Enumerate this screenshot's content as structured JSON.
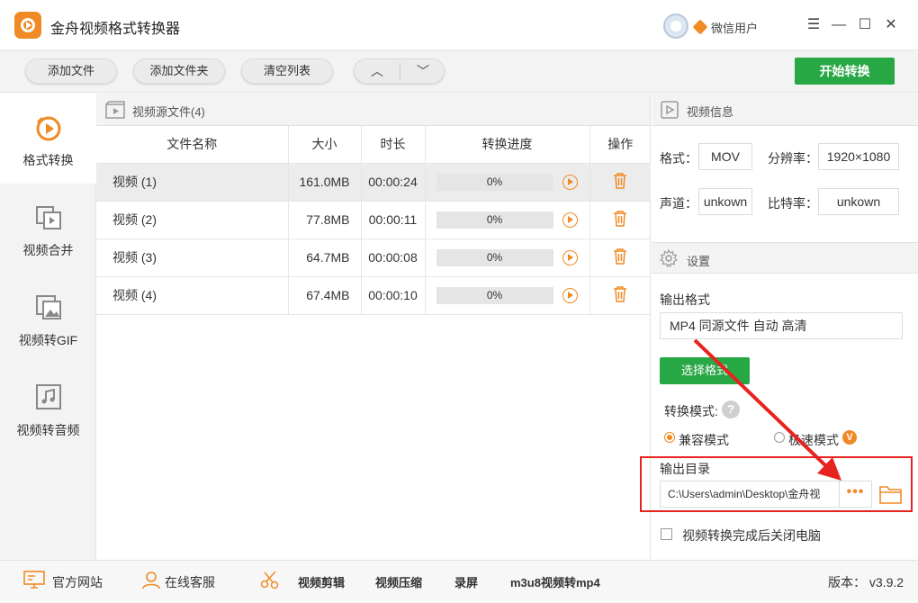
{
  "app": {
    "title": "金舟视频格式转换器",
    "user_name": "微信用户"
  },
  "window_controls": {
    "menu": "☰",
    "minimize": "—",
    "maximize": "☐",
    "close": "✕"
  },
  "toolbar": {
    "add_file": "添加文件",
    "add_folder": "添加文件夹",
    "clear_list": "清空列表",
    "move_up": "︿",
    "move_down": "﹀",
    "start_convert": "开始转换"
  },
  "sidebar": {
    "items": [
      {
        "label": "格式转换",
        "icon": "format-convert-icon",
        "active": true
      },
      {
        "label": "视频合并",
        "icon": "video-merge-icon",
        "active": false
      },
      {
        "label": "视频转GIF",
        "icon": "video-to-gif-icon",
        "active": false
      },
      {
        "label": "视频转音频",
        "icon": "video-to-audio-icon",
        "active": false
      }
    ]
  },
  "file_list": {
    "header": "视频源文件(4)",
    "columns": [
      "文件名称",
      "大小",
      "时长",
      "转换进度",
      "操作"
    ],
    "rows": [
      {
        "name": "视频 (1)",
        "size": "161.0MB",
        "duration": "00:00:24",
        "progress": 0,
        "progress_text": "0%"
      },
      {
        "name": "视频 (2)",
        "size": "77.8MB",
        "duration": "00:00:11",
        "progress": 0,
        "progress_text": "0%"
      },
      {
        "name": "视频 (3)",
        "size": "64.7MB",
        "duration": "00:00:08",
        "progress": 0,
        "progress_text": "0%"
      },
      {
        "name": "视频 (4)",
        "size": "67.4MB",
        "duration": "00:00:10",
        "progress": 0,
        "progress_text": "0%"
      }
    ]
  },
  "video_info": {
    "header": "视频信息",
    "format_label": "格式：",
    "format_value": "MOV",
    "resolution_label": "分辨率：",
    "resolution_value": "1920×1080",
    "channel_label": "声道：",
    "channel_value": "unkown",
    "bitrate_label": "比特率：",
    "bitrate_value": "unkown"
  },
  "settings": {
    "header": "设置",
    "output_format_label": "输出格式",
    "output_format_value": "MP4 同源文件 自动 高清",
    "select_format_button": "选择格式",
    "convert_mode_label": "转换模式:",
    "help": "?",
    "mode_compatible": "兼容模式",
    "mode_fast": "极速模式",
    "vip_badge": "V",
    "output_dir_label": "输出目录",
    "output_dir_value": "C:\\Users\\admin\\Desktop\\金舟视",
    "more": "•••",
    "shutdown_label": "视频转换完成后关闭电脑"
  },
  "statusbar": {
    "website": "官方网站",
    "support": "在线客服",
    "video_edit": "视频剪辑",
    "video_compress": "视频压缩",
    "screen_record": "录屏",
    "m3u8": "m3u8视频转mp4",
    "version": "版本： v3.9.2"
  },
  "colors": {
    "accent_orange": "#f08a24",
    "brand_green": "#28a745",
    "annotation_red": "#e8231f"
  }
}
